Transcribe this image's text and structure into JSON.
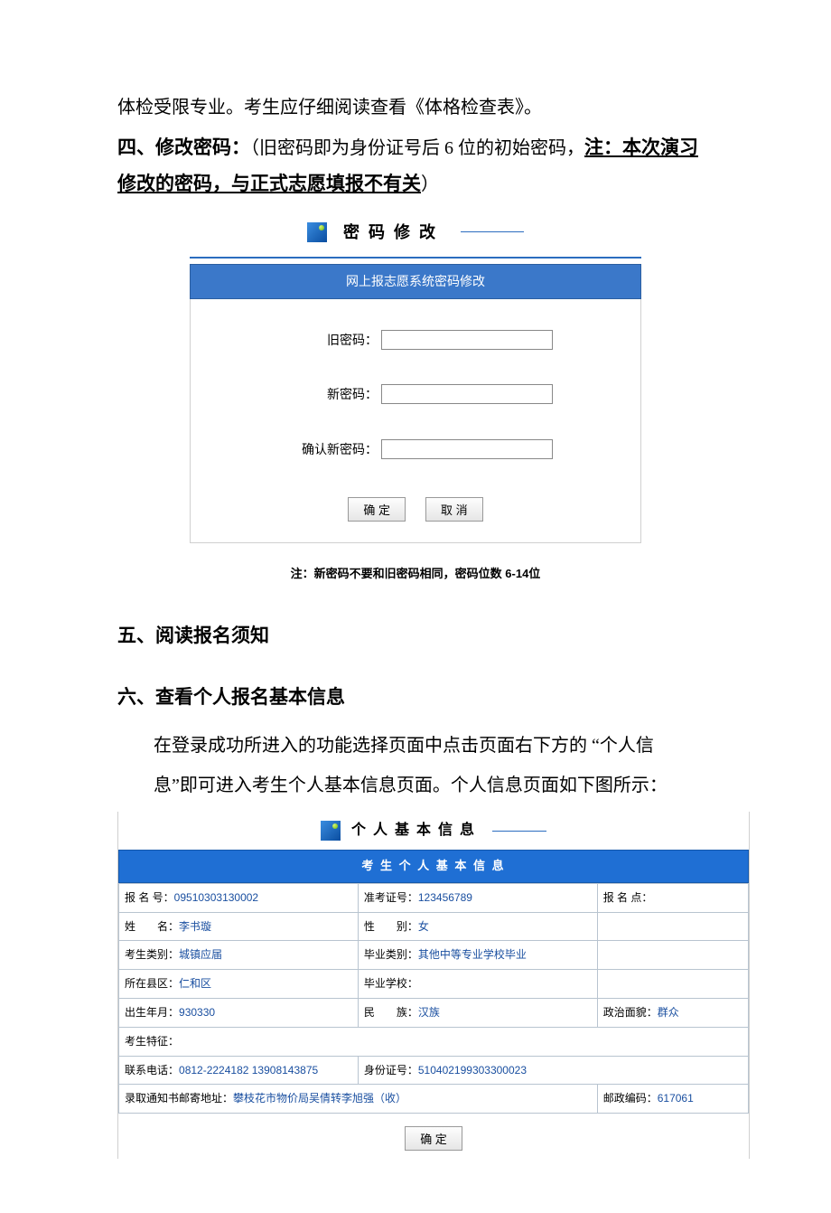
{
  "intro_line": "体检受限专业。考生应仔细阅读查看《体格检查表》。",
  "section4": {
    "prefix": "四、修改密码：",
    "desc_normal": "（旧密码即为身份证号后 6 位的初始密码，",
    "note_word": "注：",
    "underline_part": "本次演习修改的密码，与正式志愿填报不有关",
    "suffix": "）"
  },
  "pwd": {
    "header_title": "密码修改",
    "bar": "网上报志愿系统密码修改",
    "old_label": "旧密码：",
    "new_label": "新密码：",
    "confirm_label": "确认新密码：",
    "ok": "确 定",
    "cancel": "取 消",
    "note": "注：新密码不要和旧密码相同，密码位数  6-14位"
  },
  "section5": "五、阅读报名须知",
  "section6": {
    "title": "六、查看个人报名基本信息",
    "p1": "在登录成功所进入的功能选择页面中点击页面右下方的 “个人信",
    "p2": "息”即可进入考生个人基本信息页面。个人信息页面如下图所示："
  },
  "info": {
    "header_title": "个人基本信息",
    "bar": "考 生 个 人 基 本 信 息",
    "rows": {
      "regno_label": "报 名 号：",
      "regno": "09510303130002",
      "examno_label": "准考证号：",
      "examno": "123456789",
      "site_label": "报 名 点：",
      "site": "",
      "name_label": "姓　　名：",
      "name": "李书璇",
      "sex_label": "性　　别：",
      "sex": "女",
      "cat_label": "考生类别：",
      "cat": "城镇应届",
      "grad_label": "毕业类别：",
      "grad": "其他中等专业学校毕业",
      "county_label": "所在县区：",
      "county": "仁和区",
      "school_label": "毕业学校：",
      "school": "",
      "birth_label": "出生年月：",
      "birth": "930330",
      "nation_label": "民　　族：",
      "nation": "汉族",
      "pol_label": "政治面貌：",
      "pol": "群众",
      "feature_label": "考生特征：",
      "feature": "",
      "phone_label": "联系电话：",
      "phone": "0812-2224182 13908143875",
      "id_label": "身份证号：",
      "id": "510402199303300023",
      "addr_label": "录取通知书邮寄地址：",
      "addr": "攀枝花市物价局吴倩转李旭强（收）",
      "zip_label": "邮政编码：",
      "zip": "617061"
    },
    "ok": "确 定"
  }
}
